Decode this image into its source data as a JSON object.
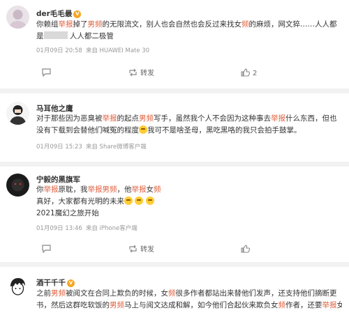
{
  "comments": [
    {
      "user": "der毛毛最",
      "text": [
        [
          "你赖组",
          [
            "举报"
          ],
          "掉了",
          [
            "男频"
          ],
          "的无限流文，别人也会自然也会反过来找女",
          [
            "频"
          ],
          "的麻烦，网文猝……人人都"
        ],
        [
          "是",
          "[blur]",
          " 人人都二极管"
        ]
      ],
      "date": "01月09日 20:58",
      "source": "来自 HUAWEI Mate 30",
      "actions": {
        "reply": "",
        "repost": "转发",
        "like": "2"
      }
    },
    {
      "user": "马耳他之鹰",
      "text": [
        [
          "对于那些因为恶臭被",
          [
            "举报"
          ],
          "的起点",
          [
            "男频"
          ],
          "写手，虽然我个人不会因为这种事去",
          [
            "举报"
          ],
          "什么东西，但也"
        ],
        [
          "没有下载到会替他们喊冤的程度",
          "[emoji]",
          "我可不是啥圣母，黑吃黑咯的我只会拍手鼓掌。"
        ]
      ],
      "date": "01月09日 15:23",
      "source": "来自 Share微博客户端",
      "actions": {
        "reply": "",
        "repost": "转发",
        "like": ""
      }
    },
    {
      "user": "宁毅的黑旗军",
      "text": [
        [
          "你",
          [
            "举报"
          ],
          "原耽，我",
          [
            "举报"
          ],
          [
            "男频"
          ],
          "，他",
          [
            "举报"
          ],
          "女",
          [
            "频"
          ]
        ],
        [
          "真好，大家都有光明的未来",
          "[emoji]",
          "[emoji]",
          "[emoji]"
        ],
        [
          "2021魔幻之旅开始"
        ]
      ],
      "date": "01月09日 13:46",
      "source": "来自 iPhone客户端",
      "actions": {
        "reply": "",
        "repost": "转发",
        "like": ""
      }
    },
    {
      "user": "酒干千千",
      "text": [
        [
          "之前",
          [
            "男频"
          ],
          "被阅文在合同上欺负的时候，女",
          [
            "频"
          ],
          "很多作者都站出来替他们发声，还支持他们摘断更"
        ],
        [
          "书，然后这群吃软饭的",
          [
            "男频"
          ],
          "马上与阅文达成和解，如今他们合起伙来欺负女",
          [
            "频"
          ],
          "作者，还要",
          [
            "举报"
          ],
          "女"
        ]
      ]
    }
  ]
}
